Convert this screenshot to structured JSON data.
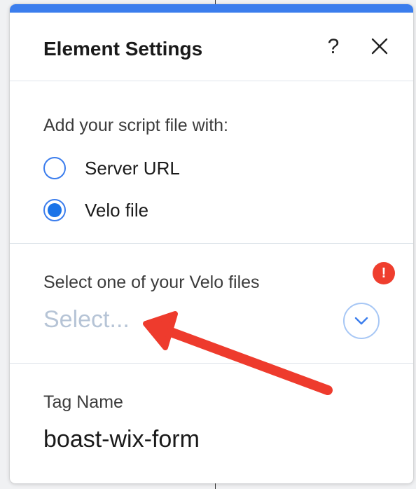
{
  "panel": {
    "title": "Element Settings",
    "help_label": "?",
    "close_icon": "close-icon"
  },
  "script_source": {
    "label": "Add your script file with:",
    "options": [
      {
        "label": "Server URL",
        "selected": false
      },
      {
        "label": "Velo file",
        "selected": true
      }
    ]
  },
  "velo_file": {
    "label": "Select one of your Velo files",
    "error_badge": "!",
    "placeholder": "Select...",
    "chevron_icon": "chevron-down-icon"
  },
  "tag": {
    "label": "Tag Name",
    "value": "boast-wix-form"
  },
  "colors": {
    "accent": "#3b7ded",
    "error": "#ef3e2e",
    "annotation_arrow": "#ee3b2d"
  }
}
